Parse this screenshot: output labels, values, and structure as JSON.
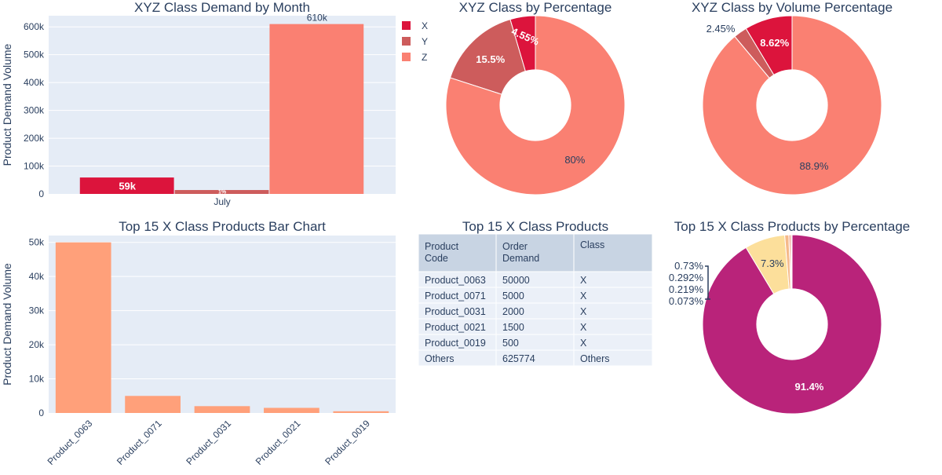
{
  "chart_data": [
    {
      "id": "demand-month",
      "type": "bar",
      "title": "XYZ Class Demand by Month",
      "ylabel": "Product Demand Volume",
      "categories": [
        "July"
      ],
      "ylim": [
        0,
        640000
      ],
      "yticks": [
        "0",
        "100k",
        "200k",
        "300k",
        "400k",
        "500k",
        "600k"
      ],
      "series": [
        {
          "name": "X",
          "values": [
            59000
          ],
          "label": "59k",
          "color": "#dc143c"
        },
        {
          "name": "Y",
          "values": [
            14000
          ],
          "label": "1%",
          "color": "#cd5c5c"
        },
        {
          "name": "Z",
          "values": [
            610000
          ],
          "label": "610k",
          "color": "#fa8072"
        }
      ],
      "legend": "top-right"
    },
    {
      "id": "class-percentage",
      "type": "pie",
      "title": "XYZ Class by Percentage",
      "hole": 0.4,
      "slices": [
        {
          "label": "X",
          "value": 4.55,
          "text": "4.55%",
          "color": "#dc143c"
        },
        {
          "label": "Y",
          "value": 15.5,
          "text": "15.5%",
          "color": "#cd5c5c"
        },
        {
          "label": "Z",
          "value": 80,
          "text": "80%",
          "color": "#fa8072"
        }
      ]
    },
    {
      "id": "volume-percentage",
      "type": "pie",
      "title": "XYZ Class by Volume Percentage",
      "hole": 0.4,
      "slices": [
        {
          "label": "X",
          "value": 8.62,
          "text": "8.62%",
          "color": "#dc143c"
        },
        {
          "label": "Y",
          "value": 2.45,
          "text": "2.45%",
          "color": "#cd5c5c"
        },
        {
          "label": "Z",
          "value": 88.9,
          "text": "88.9%",
          "color": "#fa8072"
        }
      ]
    },
    {
      "id": "top15-bar",
      "type": "bar",
      "title": "Top 15 X Class Products Bar Chart",
      "ylabel": "Product Demand Volume",
      "categories": [
        "Product_0063",
        "Product_0071",
        "Product_0031",
        "Product_0021",
        "Product_0019"
      ],
      "values": [
        50000,
        5000,
        2000,
        1500,
        500
      ],
      "ylim": [
        0,
        52000
      ],
      "yticks": [
        "0",
        "10k",
        "20k",
        "30k",
        "40k",
        "50k"
      ],
      "color": "#ffa07a"
    },
    {
      "id": "top15-table",
      "type": "table",
      "title": "Top 15 X Class Products",
      "columns": [
        "Product Code",
        "Order Demand",
        "Class"
      ],
      "rows": [
        [
          "Product_0063",
          "50000",
          "X"
        ],
        [
          "Product_0071",
          "5000",
          "X"
        ],
        [
          "Product_0031",
          "2000",
          "X"
        ],
        [
          "Product_0021",
          "1500",
          "X"
        ],
        [
          "Product_0019",
          "500",
          "X"
        ],
        [
          "Others",
          "625774",
          "Others"
        ]
      ]
    },
    {
      "id": "top15-percentage",
      "type": "pie",
      "title": "Top 15 X Class Products by Percentage",
      "hole": 0.4,
      "slices": [
        {
          "label": "Others",
          "value": 91.4,
          "text": "91.4%",
          "color": "#b9237a"
        },
        {
          "label": "Product_0063",
          "value": 7.3,
          "text": "7.3%",
          "color": "#fcdf9b"
        },
        {
          "label": "Product_0071",
          "value": 0.73,
          "text": "0.73%",
          "color": "#f5b98a"
        },
        {
          "label": "Product_0031",
          "value": 0.292,
          "text": "0.292%",
          "color": "#f09a77"
        },
        {
          "label": "Product_0021",
          "value": 0.219,
          "text": "0.219%",
          "color": "#e57b70"
        },
        {
          "label": "Product_0019",
          "value": 0.073,
          "text": "0.073%",
          "color": "#d45a74"
        }
      ]
    }
  ]
}
